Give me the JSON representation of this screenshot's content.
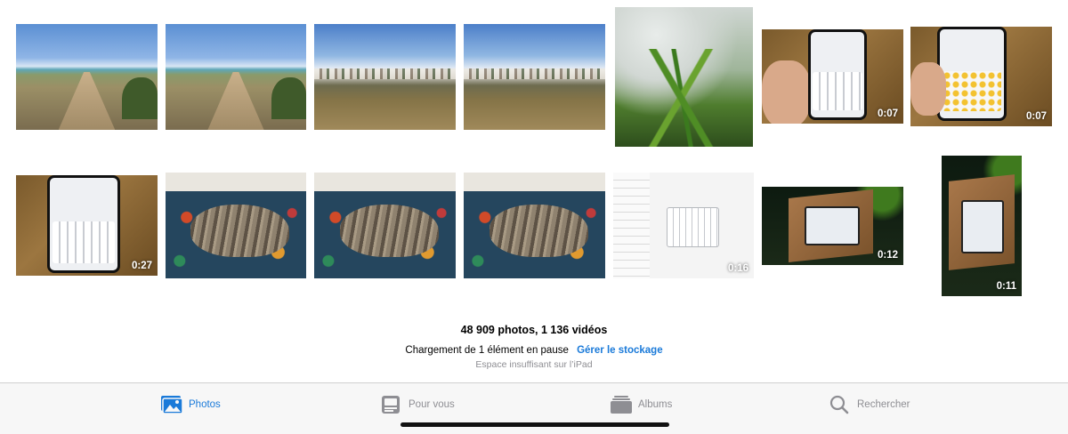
{
  "grid": {
    "items": [
      {
        "kind": "path",
        "duration": ""
      },
      {
        "kind": "path",
        "duration": ""
      },
      {
        "kind": "town",
        "duration": ""
      },
      {
        "kind": "town",
        "duration": ""
      },
      {
        "kind": "plant",
        "duration": ""
      },
      {
        "kind": "phone",
        "duration": "0:07"
      },
      {
        "kind": "emoji",
        "duration": "0:07"
      },
      {
        "kind": "phone",
        "duration": "0:27"
      },
      {
        "kind": "cat",
        "duration": ""
      },
      {
        "kind": "cat",
        "duration": ""
      },
      {
        "kind": "cat",
        "duration": ""
      },
      {
        "kind": "ipad",
        "duration": "0:16"
      },
      {
        "kind": "wood",
        "duration": "0:12"
      },
      {
        "kind": "wood",
        "duration": "0:11"
      }
    ]
  },
  "library": {
    "count_text": "48 909 photos, 1 136 vidéos",
    "status_text": "Chargement de 1 élément en pause",
    "manage_link": "Gérer le stockage",
    "sub_text": "Espace insuffisant sur l’iPad"
  },
  "tabbar": {
    "photos": {
      "label": "Photos",
      "icon": "photos-icon"
    },
    "for_you": {
      "label": "Pour vous",
      "icon": "for-you-icon"
    },
    "albums": {
      "label": "Albums",
      "icon": "albums-icon"
    },
    "search": {
      "label": "Rechercher",
      "icon": "search-icon"
    }
  },
  "colors": {
    "accent": "#1a7ad9",
    "inactive": "#8e8e93",
    "tabbar_bg": "#f7f7f7"
  }
}
